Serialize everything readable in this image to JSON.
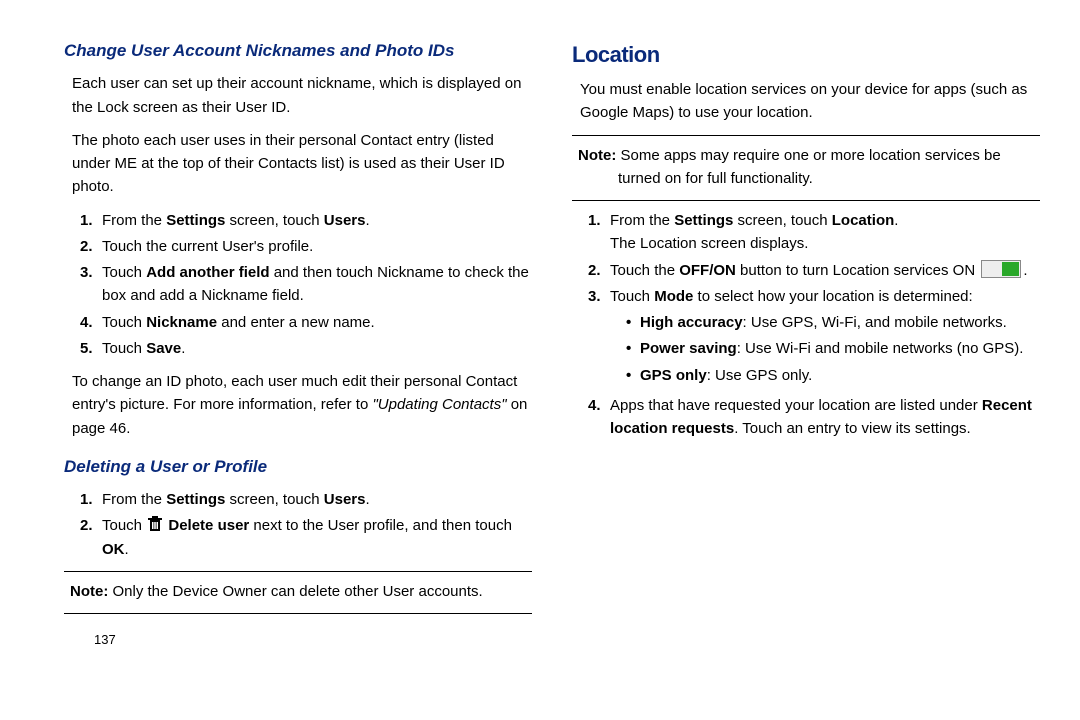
{
  "left": {
    "h1": "Change User Account Nicknames and Photo IDs",
    "p1": "Each user can set up their account nickname, which is displayed on the Lock screen as their User ID.",
    "p2": "The photo each user uses in their personal Contact entry (listed under ME at the top of their Contacts list) is used as their User ID photo.",
    "steps1": {
      "n1": "1.",
      "s1a": "From the ",
      "s1b": "Settings",
      "s1c": " screen, touch ",
      "s1d": "Users",
      "s1e": ".",
      "n2": "2.",
      "s2": "Touch the current User's profile.",
      "n3": "3.",
      "s3a": "Touch ",
      "s3b": "Add another field",
      "s3c": " and then touch Nickname to check the box and add a Nickname field.",
      "n4": "4.",
      "s4a": "Touch ",
      "s4b": "Nickname",
      "s4c": " and enter a new name.",
      "n5": "5.",
      "s5a": "Touch ",
      "s5b": "Save",
      "s5c": "."
    },
    "p3a": "To change an ID photo, each user much edit their personal Contact entry's picture. For more information, refer to ",
    "p3b": "\"Updating Contacts\"",
    "p3c": " on page 46.",
    "h2": "Deleting a User or Profile",
    "steps2": {
      "n1": "1.",
      "s1a": "From the ",
      "s1b": "Settings",
      "s1c": " screen, touch ",
      "s1d": "Users",
      "s1e": ".",
      "n2": "2.",
      "s2a": "Touch ",
      "s2b": "Delete user",
      "s2c": " next to the User profile, and then touch ",
      "s2d": "OK",
      "s2e": "."
    },
    "noteLabel": "Note:",
    "note": " Only the Device Owner can delete other User accounts.",
    "page": "137"
  },
  "right": {
    "h1": "Location",
    "p1": "You must enable location services on your device for apps (such as Google Maps) to use your location.",
    "noteLabel": "Note:",
    "note": " Some apps may require one or more location services be turned on for full functionality.",
    "steps": {
      "n1": "1.",
      "s1a": "From the ",
      "s1b": "Settings",
      "s1c": " screen, touch ",
      "s1d": "Location",
      "s1e": ".",
      "s1f": "The Location screen displays.",
      "n2": "2.",
      "s2a": "Touch the ",
      "s2b": "OFF/ON",
      "s2c": " button to turn Location services ON ",
      "s2d": ".",
      "n3": "3.",
      "s3a": "Touch ",
      "s3b": "Mode",
      "s3c": " to select how your location is determined:",
      "b1a": "High accuracy",
      "b1b": ": Use GPS, Wi-Fi, and mobile networks.",
      "b2a": "Power saving",
      "b2b": ": Use Wi-Fi and mobile networks (no GPS).",
      "b3a": "GPS only",
      "b3b": ": Use GPS only.",
      "n4": "4.",
      "s4a": "Apps that have requested your location are listed under ",
      "s4b": "Recent location requests",
      "s4c": ". Touch an entry to view its settings."
    }
  }
}
